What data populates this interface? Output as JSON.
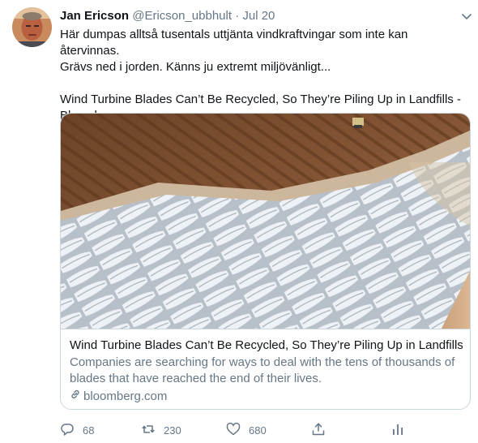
{
  "tweet": {
    "author_name": "Jan Ericson",
    "handle": "@Ericson_ubbhult",
    "separator": "·",
    "date": "Jul 20",
    "text_line1": "Här dumpas alltså tusentals uttjänta vindkraftvingar som inte kan återvinnas.",
    "text_line2": "Grävs ned i jorden. Känns ju extremt miljövänligt...",
    "link_title_line1": "Wind Turbine Blades Can’t Be Recycled, So They’re Piling Up in Landfills -",
    "link_title_line2": "Bloomberg"
  },
  "card": {
    "title": "Wind Turbine Blades Can’t Be Recycled, So They’re Piling Up in Landfills",
    "description": "Companies are searching for ways to deal with the tens of thousands of blades that have reached the end of their lives.",
    "domain": "bloomberg.com"
  },
  "actions": {
    "reply_count": "68",
    "retweet_count": "230",
    "like_count": "680"
  },
  "colors": {
    "text": "#0f1419",
    "secondary": "#657786",
    "border": "#ccd6dd"
  }
}
